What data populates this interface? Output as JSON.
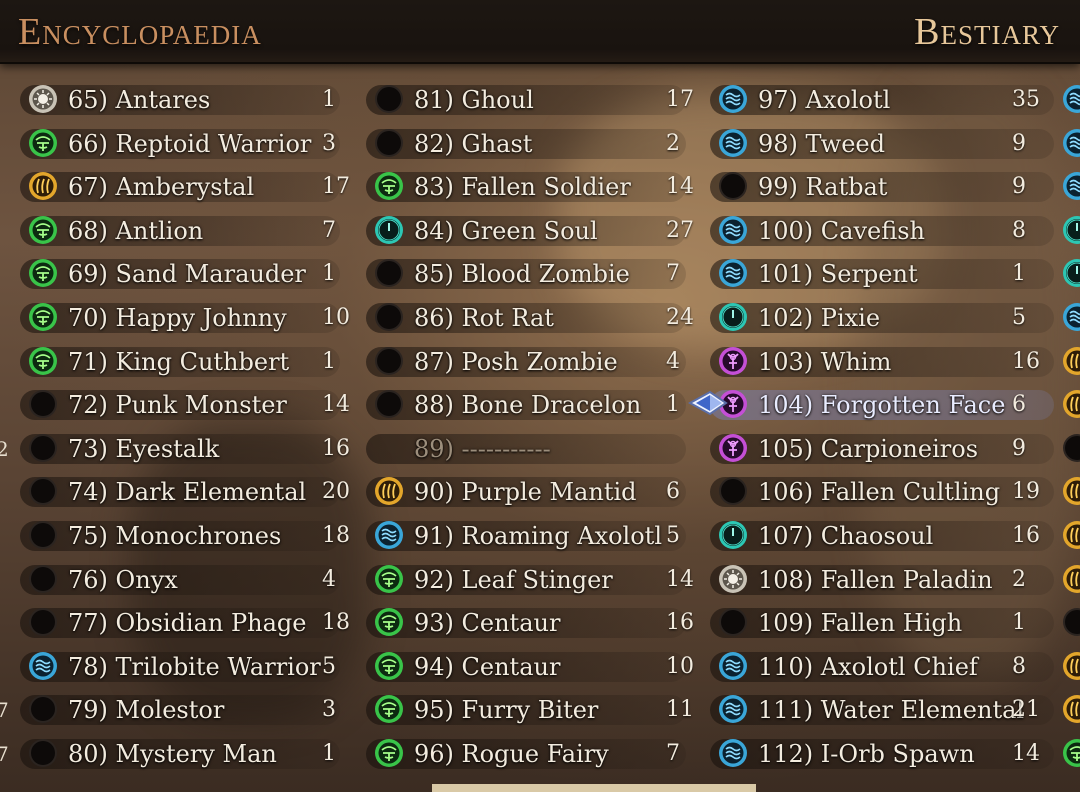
{
  "header": {
    "left_title": "Encyclopaedia",
    "right_title": "Bestiary"
  },
  "colors": {
    "green": "#39c449",
    "gold": "#e3a62b",
    "blue": "#3aa6d8",
    "teal": "#2cc7b4",
    "purple": "#c44fd6",
    "dark": "#0d0a09",
    "silver": "#c9c3b6",
    "selected_row": "#7f83b3"
  },
  "columns": [
    {
      "entries": [
        {
          "label": "65) Antares",
          "count": "1",
          "icon": "silver-sun-icon"
        },
        {
          "label": "66) Reptoid Warrior",
          "count": "3",
          "icon": "green-plant-icon"
        },
        {
          "label": "67) Amberystal",
          "count": "17",
          "icon": "gold-flame-icon"
        },
        {
          "label": "68) Antlion",
          "count": "7",
          "icon": "green-plant-icon"
        },
        {
          "label": "69) Sand Marauder",
          "count": "1",
          "icon": "green-plant-icon"
        },
        {
          "label": "70) Happy Johnny",
          "count": "10",
          "icon": "green-plant-icon"
        },
        {
          "label": "71) King Cuthbert",
          "count": "1",
          "icon": "green-plant-icon"
        },
        {
          "label": "72) Punk Monster",
          "count": "14",
          "icon": "dark-void-icon"
        },
        {
          "label": "73) Eyestalk",
          "count": "16",
          "icon": "dark-void-icon"
        },
        {
          "label": "74) Dark Elemental",
          "count": "20",
          "icon": "dark-void-icon"
        },
        {
          "label": "75) Monochrones",
          "count": "18",
          "icon": "dark-void-icon"
        },
        {
          "label": "76) Onyx",
          "count": "4",
          "icon": "dark-void-icon"
        },
        {
          "label": "77) Obsidian Phage",
          "count": "18",
          "icon": "dark-void-icon"
        },
        {
          "label": "78) Trilobite Warrior",
          "count": "5",
          "icon": "blue-water-icon"
        },
        {
          "label": "79) Molestor",
          "count": "3",
          "icon": "dark-void-icon"
        },
        {
          "label": "80) Mystery Man",
          "count": "1",
          "icon": "dark-void-icon"
        }
      ]
    },
    {
      "entries": [
        {
          "label": "81) Ghoul",
          "count": "17",
          "icon": "dark-void-icon"
        },
        {
          "label": "82) Ghast",
          "count": "2",
          "icon": "dark-void-icon"
        },
        {
          "label": "83) Fallen Soldier",
          "count": "14",
          "icon": "green-plant-icon"
        },
        {
          "label": "84) Green Soul",
          "count": "27",
          "icon": "teal-spirit-icon"
        },
        {
          "label": "85) Blood Zombie",
          "count": "7",
          "icon": "dark-void-icon"
        },
        {
          "label": "86) Rot Rat",
          "count": "24",
          "icon": "dark-void-icon"
        },
        {
          "label": "87) Posh Zombie",
          "count": "4",
          "icon": "dark-void-icon"
        },
        {
          "label": "88) Bone Dracelon",
          "count": "1",
          "icon": "dark-void-icon"
        },
        {
          "label": "89) -----------",
          "count": "",
          "icon": "none"
        },
        {
          "label": "90) Purple Mantid",
          "count": "6",
          "icon": "gold-flame-icon"
        },
        {
          "label": "91) Roaming Axolotl",
          "count": "5",
          "icon": "blue-water-icon"
        },
        {
          "label": "92) Leaf Stinger",
          "count": "14",
          "icon": "green-plant-icon"
        },
        {
          "label": "93) Centaur",
          "count": "16",
          "icon": "green-plant-icon"
        },
        {
          "label": "94) Centaur",
          "count": "10",
          "icon": "green-plant-icon"
        },
        {
          "label": "95) Furry Biter",
          "count": "11",
          "icon": "green-plant-icon"
        },
        {
          "label": "96) Rogue Fairy",
          "count": "7",
          "icon": "green-plant-icon"
        }
      ]
    },
    {
      "entries": [
        {
          "label": "97) Axolotl",
          "count": "35",
          "icon": "blue-water-icon"
        },
        {
          "label": "98) Tweed",
          "count": "9",
          "icon": "blue-water-icon"
        },
        {
          "label": "99) Ratbat",
          "count": "9",
          "icon": "dark-void-icon"
        },
        {
          "label": "100) Cavefish",
          "count": "8",
          "icon": "blue-water-icon"
        },
        {
          "label": "101) Serpent",
          "count": "1",
          "icon": "blue-water-icon"
        },
        {
          "label": "102) Pixie",
          "count": "5",
          "icon": "teal-spirit-icon"
        },
        {
          "label": "103) Whim",
          "count": "16",
          "icon": "purple-ankh-icon"
        },
        {
          "label": "104) Forgotten Face",
          "count": "6",
          "icon": "purple-ankh-icon",
          "selected": true
        },
        {
          "label": "105) Carpioneiros",
          "count": "9",
          "icon": "purple-ankh-icon"
        },
        {
          "label": "106) Fallen Cultling",
          "count": "19",
          "icon": "dark-void-icon"
        },
        {
          "label": "107) Chaosoul",
          "count": "16",
          "icon": "teal-spirit-icon"
        },
        {
          "label": "108) Fallen Paladin",
          "count": "2",
          "icon": "silver-sun-icon"
        },
        {
          "label": "109) Fallen High",
          "count": "1",
          "icon": "dark-void-icon"
        },
        {
          "label": "110) Axolotl Chief",
          "count": "8",
          "icon": "blue-water-icon"
        },
        {
          "label": "111) Water Elemental",
          "count": "21",
          "icon": "blue-water-icon"
        },
        {
          "label": "112) I-Orb Spawn",
          "count": "14",
          "icon": "blue-water-icon"
        }
      ]
    }
  ],
  "edge_icons": [
    "blue-water-icon",
    "blue-water-icon",
    "blue-water-icon",
    "teal-spirit-icon",
    "teal-spirit-icon",
    "blue-water-icon",
    "gold-flame-icon",
    "gold-flame-icon",
    "dark-void-icon",
    "gold-flame-icon",
    "gold-flame-icon",
    "gold-flame-icon",
    "dark-void-icon",
    "gold-flame-icon",
    "gold-flame-icon",
    "green-plant-icon"
  ],
  "edge_left_numbers": [
    "2",
    "7",
    "7"
  ]
}
